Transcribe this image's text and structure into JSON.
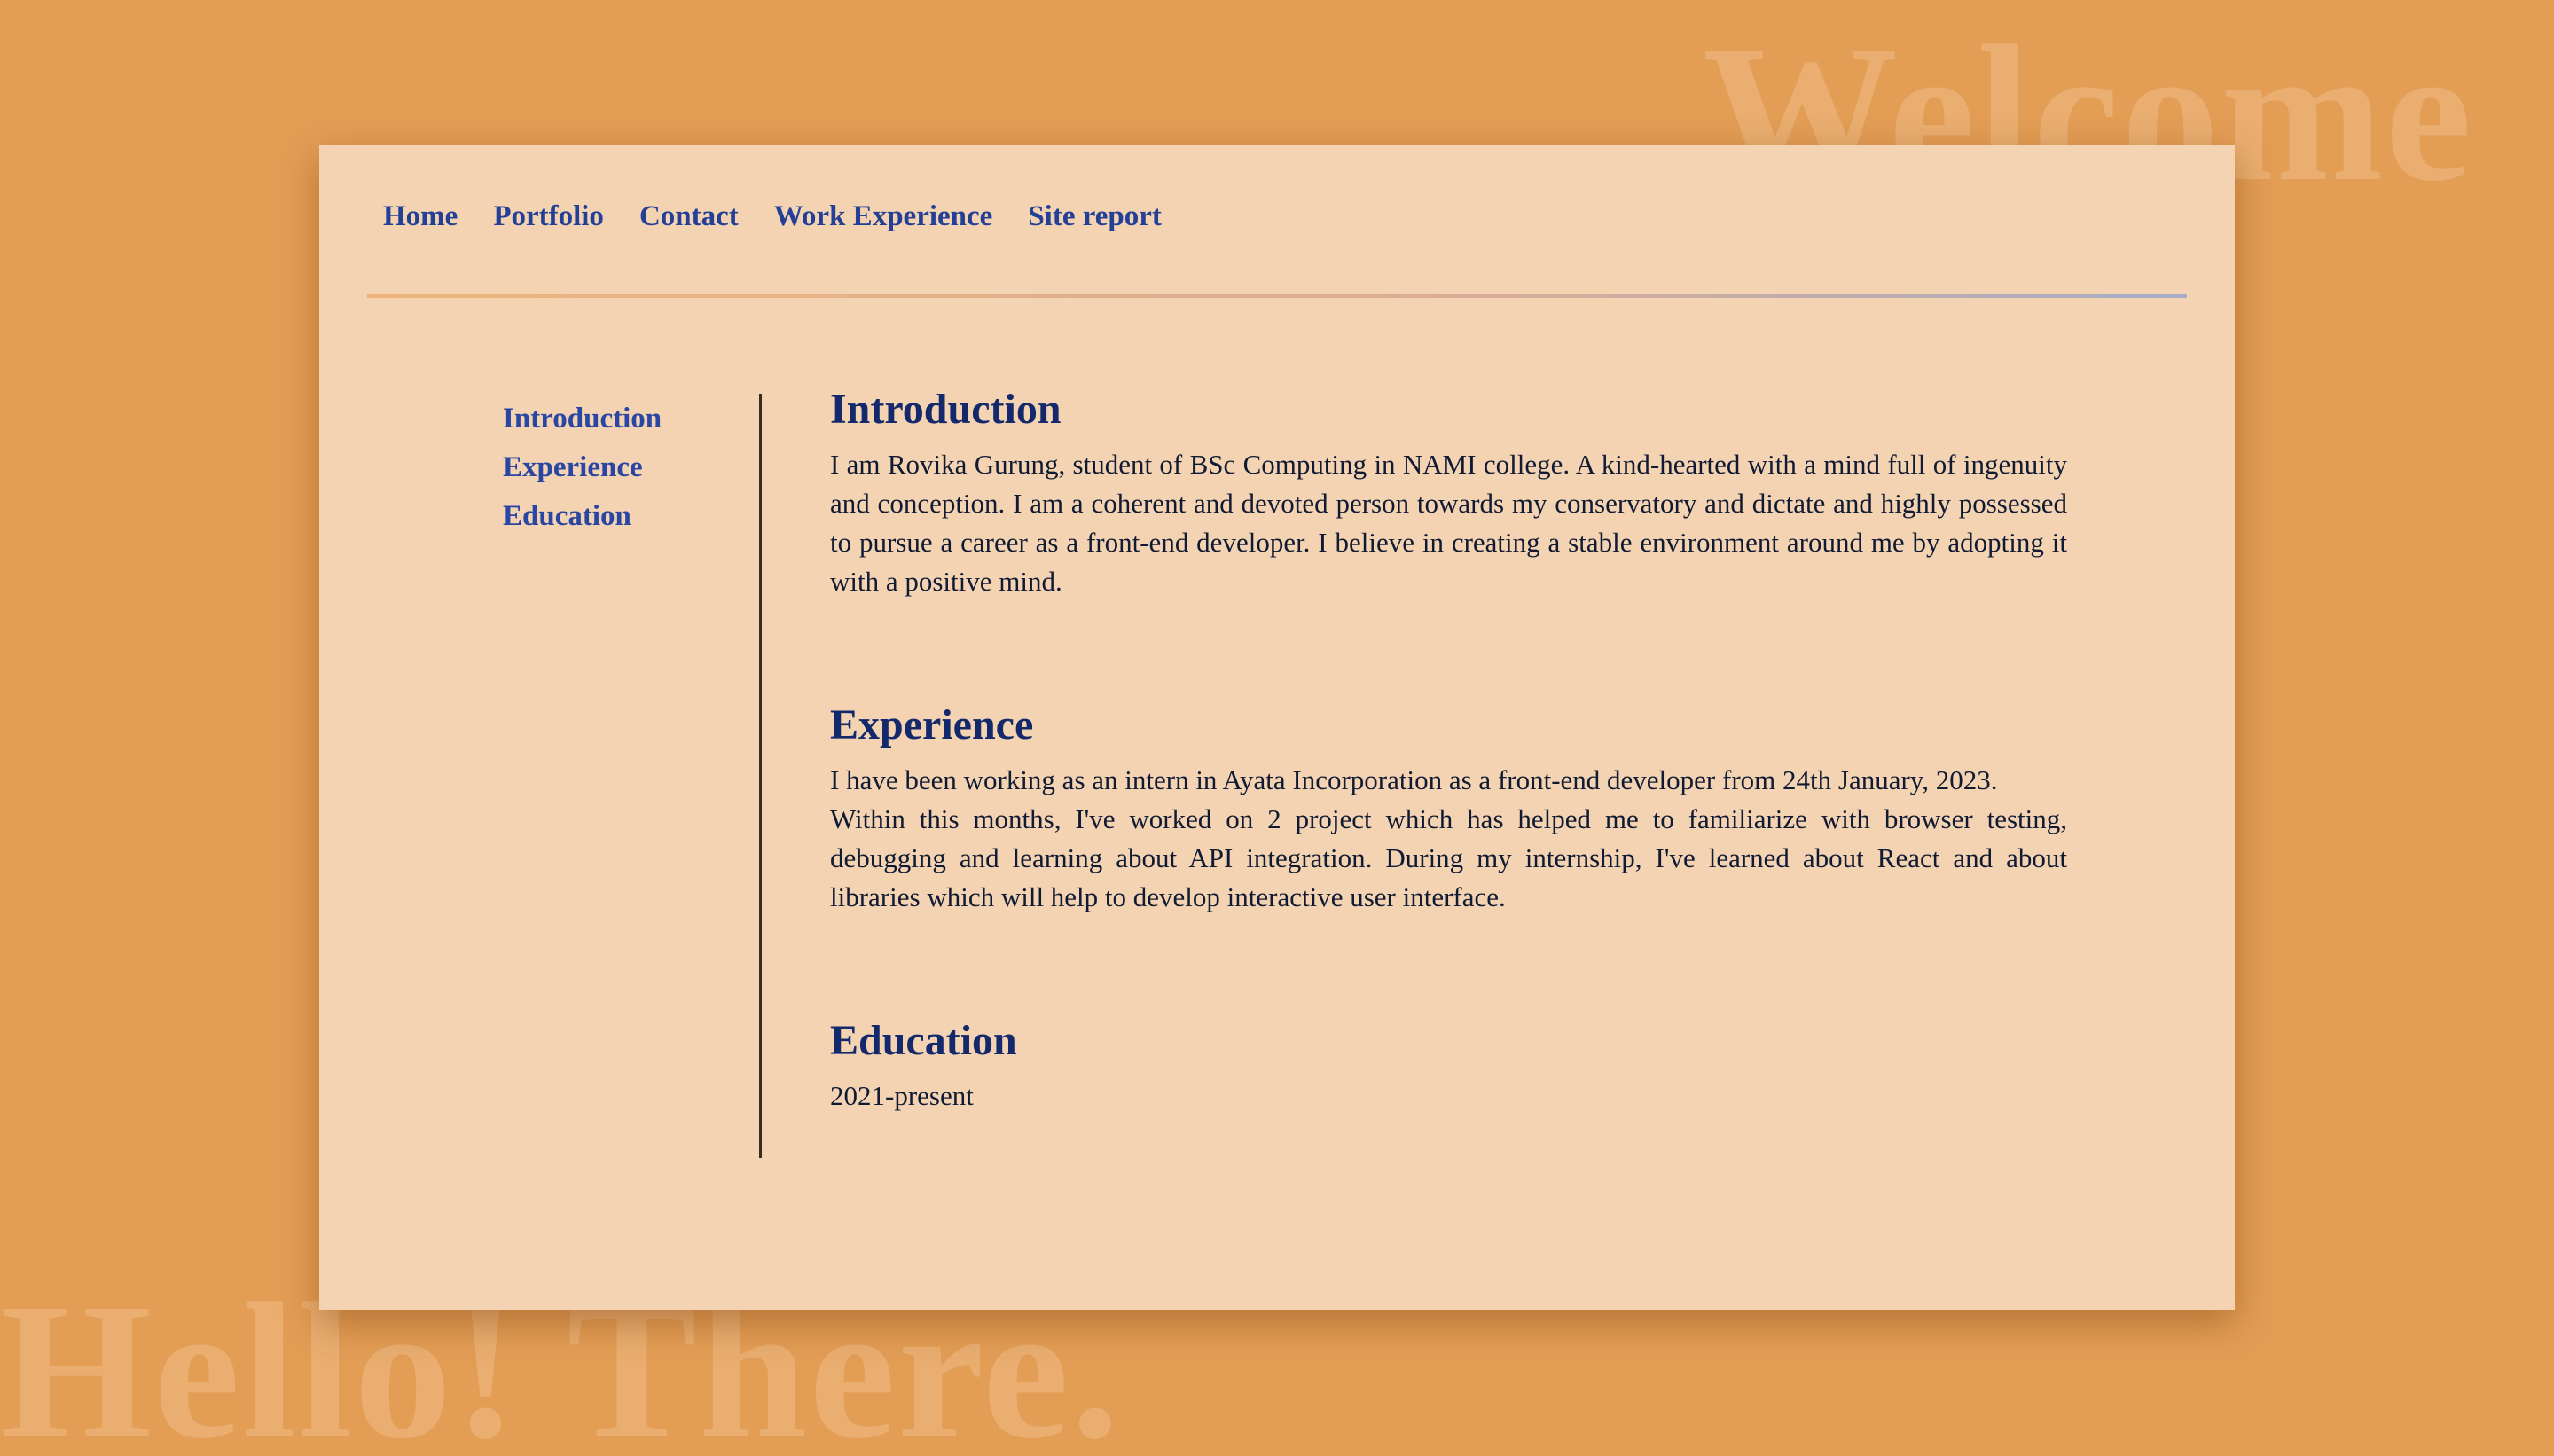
{
  "background": {
    "welcome_text": "Welcome",
    "hello_text": "Hello! There.",
    "bg_color": "#e39d55",
    "card_color": "#f3d3b2"
  },
  "topnav": {
    "items": [
      "Home",
      "Portfolio",
      "Contact",
      "Work Experience",
      "Site report"
    ],
    "link_color": "#243f96"
  },
  "side_menu": {
    "items": [
      "Introduction",
      "Experience",
      "Education"
    ]
  },
  "sections": {
    "introduction": {
      "title": "Introduction",
      "text": "I am Rovika Gurung, student of BSc Computing in NAMI college. A kind-hearted with a mind full of ingenuity and conception. I am a coherent and devoted person towards my conservatory and dictate and highly possessed to pursue a career as a front-end developer. I believe in creating a stable environment around me by adopting it with a positive mind."
    },
    "experience": {
      "title": "Experience",
      "text_1": "I have been working as an intern in Ayata Incorporation as a front-end developer from 24th January, 2023.",
      "text_2": "Within this months, I've worked on 2 project which has helped me to familiarize with browser testing, debugging and learning about API integration. During my internship, I've learned about React and about libraries which will help to develop interactive user interface."
    },
    "education": {
      "title": "Education",
      "text": "2021-present"
    }
  },
  "heading_color": "#13296c"
}
